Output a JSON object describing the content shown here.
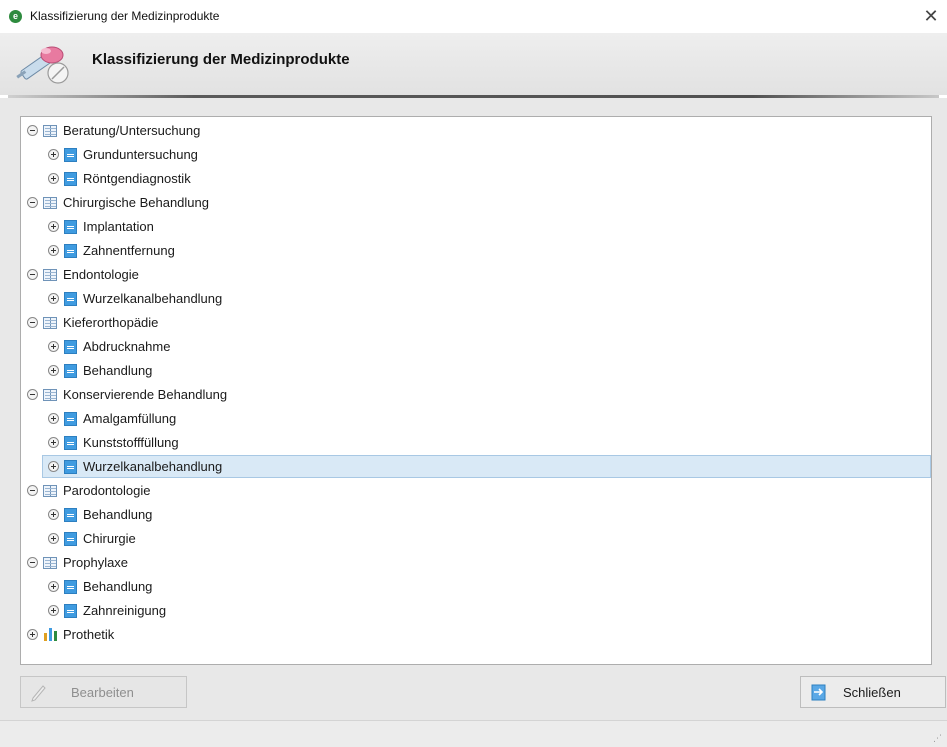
{
  "window": {
    "title": "Klassifizierung der Medizinprodukte",
    "app_icon_glyph": "e",
    "close_glyph": "✕"
  },
  "header": {
    "title": "Klassifizierung der Medizinprodukte",
    "icon": "medical-supplies-icon"
  },
  "tree": {
    "items": [
      {
        "label": "Beratung/Untersuchung",
        "level": 0,
        "expanded": true,
        "icon": "book-icon"
      },
      {
        "label": "Grunduntersuchung",
        "level": 1,
        "expanded": false,
        "icon": "document-icon"
      },
      {
        "label": "Röntgendiagnostik",
        "level": 1,
        "expanded": false,
        "icon": "document-icon"
      },
      {
        "label": "Chirurgische Behandlung",
        "level": 0,
        "expanded": true,
        "icon": "book-icon"
      },
      {
        "label": "Implantation",
        "level": 1,
        "expanded": false,
        "icon": "document-icon"
      },
      {
        "label": "Zahnentfernung",
        "level": 1,
        "expanded": false,
        "icon": "document-icon"
      },
      {
        "label": "Endontologie",
        "level": 0,
        "expanded": true,
        "icon": "book-icon"
      },
      {
        "label": "Wurzelkanalbehandlung",
        "level": 1,
        "expanded": false,
        "icon": "document-icon"
      },
      {
        "label": "Kieferorthopädie",
        "level": 0,
        "expanded": true,
        "icon": "book-icon"
      },
      {
        "label": "Abdrucknahme",
        "level": 1,
        "expanded": false,
        "icon": "document-icon"
      },
      {
        "label": "Behandlung",
        "level": 1,
        "expanded": false,
        "icon": "document-icon"
      },
      {
        "label": "Konservierende Behandlung",
        "level": 0,
        "expanded": true,
        "icon": "book-icon"
      },
      {
        "label": "Amalgamfüllung",
        "level": 1,
        "expanded": false,
        "icon": "document-icon"
      },
      {
        "label": "Kunststofffüllung",
        "level": 1,
        "expanded": false,
        "icon": "document-icon"
      },
      {
        "label": "Wurzelkanalbehandlung",
        "level": 1,
        "expanded": false,
        "icon": "document-icon",
        "selected": true
      },
      {
        "label": "Parodontologie",
        "level": 0,
        "expanded": true,
        "icon": "book-icon"
      },
      {
        "label": "Behandlung",
        "level": 1,
        "expanded": false,
        "icon": "document-icon"
      },
      {
        "label": "Chirurgie",
        "level": 1,
        "expanded": false,
        "icon": "document-icon"
      },
      {
        "label": "Prophylaxe",
        "level": 0,
        "expanded": true,
        "icon": "book-icon"
      },
      {
        "label": "Behandlung",
        "level": 1,
        "expanded": false,
        "icon": "document-icon"
      },
      {
        "label": "Zahnreinigung",
        "level": 1,
        "expanded": false,
        "icon": "document-icon"
      },
      {
        "label": "Prothetik",
        "level": 0,
        "expanded": false,
        "icon": "bar-chart-icon"
      }
    ]
  },
  "buttons": {
    "edit_label": "Bearbeiten",
    "edit_enabled": false,
    "close_label": "Schließen"
  },
  "colors": {
    "selection": "#d9e9f6",
    "document_icon": "#3f9be0",
    "app_icon": "#2e8b3e"
  }
}
